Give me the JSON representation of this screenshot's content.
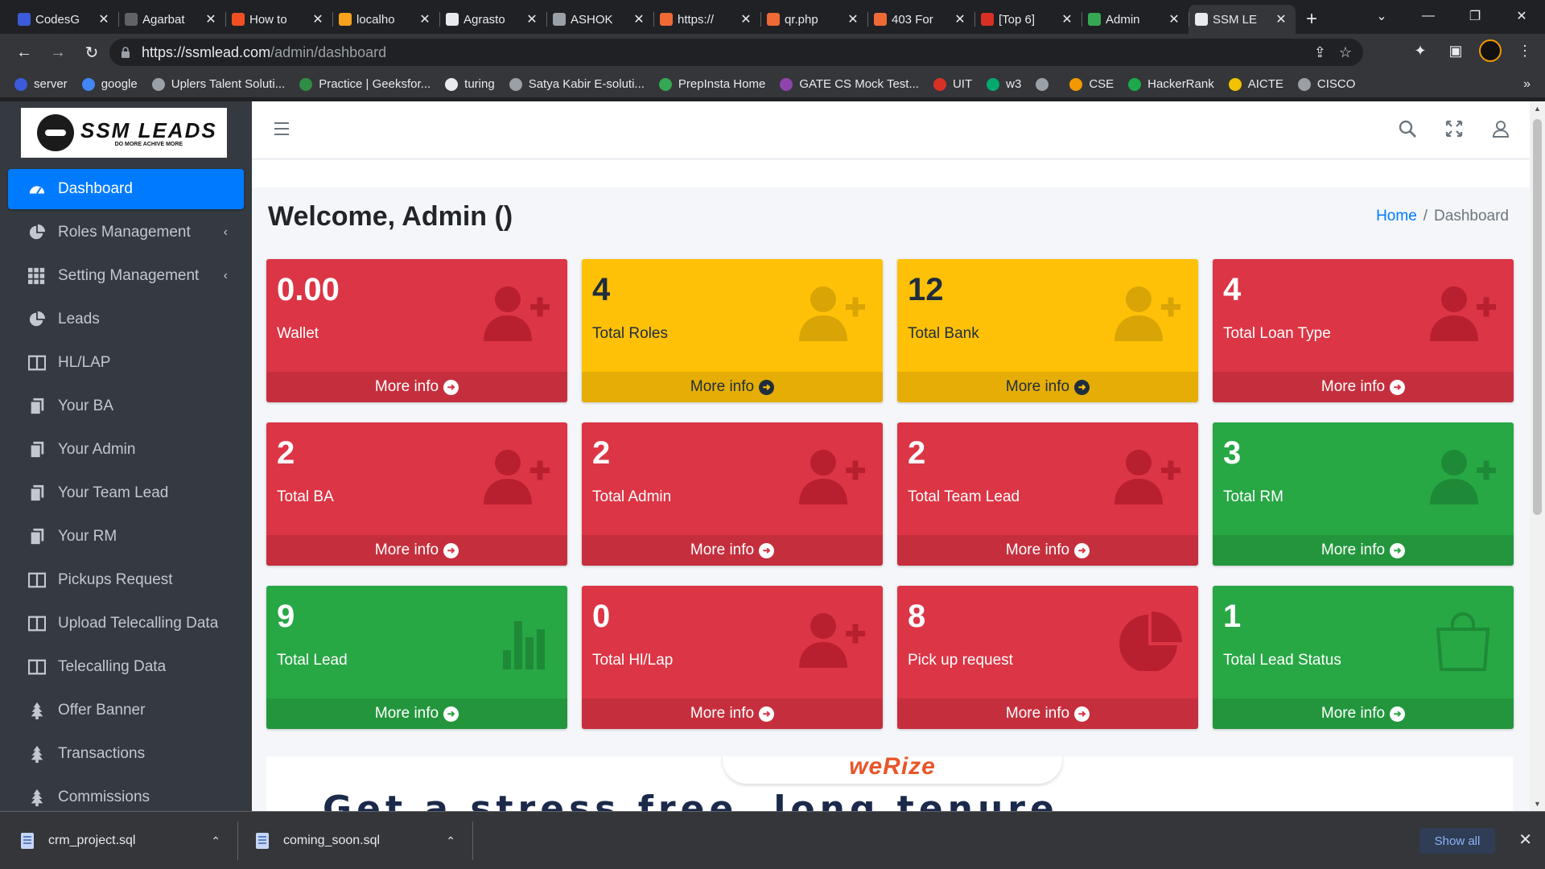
{
  "browser": {
    "tabs": [
      {
        "title": "CodesG",
        "favicon_color": "#3b5bdb",
        "active": false
      },
      {
        "title": "Agarbat",
        "favicon_color": "#5f6368",
        "active": false
      },
      {
        "title": "How to",
        "favicon_color": "#f25022",
        "active": false
      },
      {
        "title": "localho",
        "favicon_color": "#f7a21b",
        "active": false
      },
      {
        "title": "Agrasto",
        "favicon_color": "#e8eaed",
        "active": false
      },
      {
        "title": "ASHOK",
        "favicon_color": "#9aa0a6",
        "active": false
      },
      {
        "title": "https://",
        "favicon_color": "#f06a35",
        "active": false
      },
      {
        "title": "qr.php",
        "favicon_color": "#f06a35",
        "active": false
      },
      {
        "title": "403 For",
        "favicon_color": "#f06a35",
        "active": false
      },
      {
        "title": "[Top 6]",
        "favicon_color": "#d93025",
        "active": false
      },
      {
        "title": "Admin",
        "favicon_color": "#34a853",
        "active": false
      },
      {
        "title": "SSM LE",
        "favicon_color": "#e8eaed",
        "active": true
      }
    ],
    "tab_close": "✕",
    "new_tab": "+",
    "url_domain": "https://ssmlead.com",
    "url_path": "/admin/dashboard",
    "bookmarks": [
      {
        "label": "server",
        "color": "#3b5bdb"
      },
      {
        "label": "google",
        "color": "#4285f4"
      },
      {
        "label": "Uplers Talent Soluti...",
        "color": "#9aa0a6"
      },
      {
        "label": "Practice | Geeksfor...",
        "color": "#2f8d46"
      },
      {
        "label": "turing",
        "color": "#e8eaed"
      },
      {
        "label": "Satya Kabir E-soluti...",
        "color": "#9aa0a6"
      },
      {
        "label": "PrepInsta Home",
        "color": "#34a853"
      },
      {
        "label": "GATE CS Mock Test...",
        "color": "#8e44ad"
      },
      {
        "label": "UIT",
        "color": "#d93025"
      },
      {
        "label": "w3",
        "color": "#04aa6d"
      },
      {
        "label": "",
        "color": "#9aa0a6"
      },
      {
        "label": "CSE",
        "color": "#f29900"
      },
      {
        "label": "HackerRank",
        "color": "#1ba94c"
      },
      {
        "label": "AICTE",
        "color": "#f2c200"
      },
      {
        "label": "CISCO",
        "color": "#9aa0a6"
      }
    ],
    "bookmarks_more": "»"
  },
  "sidebar": {
    "brand_name": "SSM LEADS",
    "brand_tagline": "DO MORE ACHIVE MORE",
    "items": [
      {
        "label": "Dashboard",
        "icon": "speedometer-icon",
        "active": true,
        "caret": false
      },
      {
        "label": "Roles Management",
        "icon": "pie-chart-icon",
        "active": false,
        "caret": true
      },
      {
        "label": "Setting Management",
        "icon": "grid-icon",
        "active": false,
        "caret": true
      },
      {
        "label": "Leads",
        "icon": "pie-chart-icon",
        "active": false,
        "caret": false
      },
      {
        "label": "HL/LAP",
        "icon": "columns-icon",
        "active": false,
        "caret": false
      },
      {
        "label": "Your BA",
        "icon": "copy-icon",
        "active": false,
        "caret": false
      },
      {
        "label": "Your Admin",
        "icon": "copy-icon",
        "active": false,
        "caret": false
      },
      {
        "label": "Your Team Lead",
        "icon": "copy-icon",
        "active": false,
        "caret": false
      },
      {
        "label": "Your RM",
        "icon": "copy-icon",
        "active": false,
        "caret": false
      },
      {
        "label": "Pickups Request",
        "icon": "columns-icon",
        "active": false,
        "caret": false
      },
      {
        "label": "Upload Telecalling Data",
        "icon": "columns-icon",
        "active": false,
        "caret": false
      },
      {
        "label": "Telecalling Data",
        "icon": "columns-icon",
        "active": false,
        "caret": false
      },
      {
        "label": "Offer Banner",
        "icon": "tree-icon",
        "active": false,
        "caret": false
      },
      {
        "label": "Transactions",
        "icon": "tree-icon",
        "active": false,
        "caret": false
      },
      {
        "label": "Commissions",
        "icon": "tree-icon",
        "active": false,
        "caret": false
      }
    ],
    "caret_glyph": "‹"
  },
  "main": {
    "title": "Welcome, Admin ()",
    "breadcrumb_home": "Home",
    "breadcrumb_sep": "/",
    "breadcrumb_current": "Dashboard",
    "more_info": "More info",
    "more_info_arrow": "➜",
    "colors": {
      "red": "#dc3545",
      "yellow": "#ffc107",
      "green": "#28a745"
    },
    "cards": [
      {
        "value": "0.00",
        "label": "Wallet",
        "color": "red",
        "icon": "user-plus-icon"
      },
      {
        "value": "4",
        "label": "Total Roles",
        "color": "yellow",
        "icon": "user-plus-icon"
      },
      {
        "value": "12",
        "label": "Total Bank",
        "color": "yellow",
        "icon": "user-plus-icon"
      },
      {
        "value": "4",
        "label": "Total Loan Type",
        "color": "red",
        "icon": "user-plus-icon"
      },
      {
        "value": "2",
        "label": "Total BA",
        "color": "red",
        "icon": "user-plus-icon"
      },
      {
        "value": "2",
        "label": "Total Admin",
        "color": "red",
        "icon": "user-plus-icon"
      },
      {
        "value": "2",
        "label": "Total Team Lead",
        "color": "red",
        "icon": "user-plus-icon"
      },
      {
        "value": "3",
        "label": "Total RM",
        "color": "green",
        "icon": "user-plus-icon"
      },
      {
        "value": "9",
        "label": "Total Lead",
        "color": "green",
        "icon": "bar-chart-icon"
      },
      {
        "value": "0",
        "label": "Total Hl/Lap",
        "color": "red",
        "icon": "user-plus-icon"
      },
      {
        "value": "8",
        "label": "Pick up request",
        "color": "red",
        "icon": "pie-chart-icon"
      },
      {
        "value": "1",
        "label": "Total Lead Status",
        "color": "green",
        "icon": "shopping-bag-icon"
      }
    ],
    "banner_logo": "weRize",
    "banner_headline": "Get a stress free, long tenure"
  },
  "downloads": {
    "items": [
      {
        "filename": "crm_project.sql"
      },
      {
        "filename": "coming_soon.sql"
      }
    ],
    "show_all": "Show all",
    "close": "✕",
    "chevron": "⌃"
  }
}
